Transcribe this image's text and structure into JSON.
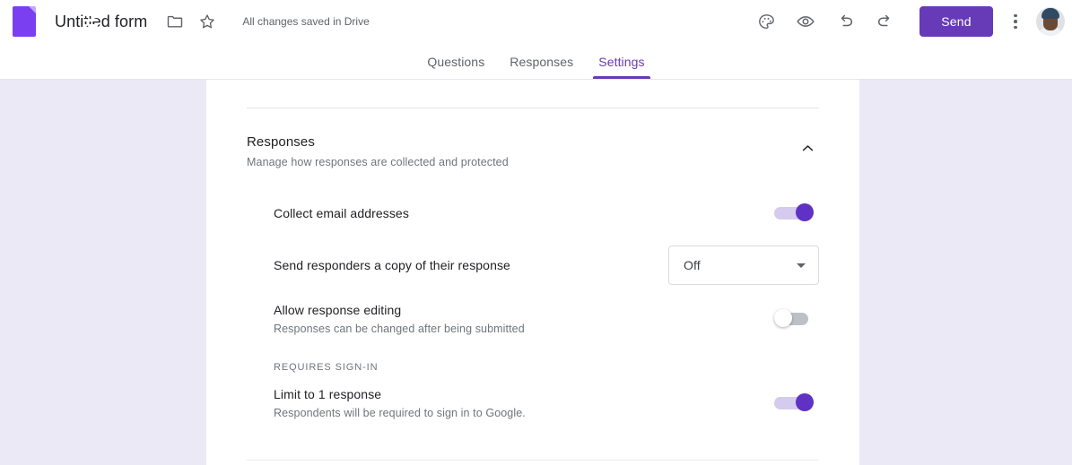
{
  "topbar": {
    "logo_icon": "google-forms-icon",
    "form_title": "Untitled form",
    "folder_icon": "folder-icon",
    "star_icon": "star-icon",
    "save_status": "All changes saved in Drive",
    "theme_icon": "palette-icon",
    "preview_icon": "eye-icon",
    "undo_icon": "undo-icon",
    "redo_icon": "redo-icon",
    "send_label": "Send",
    "more_icon": "more-vertical-icon",
    "avatar_name": "account-avatar",
    "accent_color": "#673ab7"
  },
  "tabs": [
    {
      "label": "Questions",
      "active": false
    },
    {
      "label": "Responses",
      "active": false
    },
    {
      "label": "Settings",
      "active": true
    }
  ],
  "responses_section": {
    "title": "Responses",
    "subtitle": "Manage how responses are collected and protected",
    "collapse_icon": "chevron-up-icon",
    "settings": [
      {
        "label": "Collect email addresses",
        "sublabel": "",
        "control": "toggle",
        "state": "on"
      },
      {
        "label": "Send responders a copy of their response",
        "sublabel": "",
        "control": "dropdown",
        "value": "Off",
        "caret_icon": "chevron-down-icon"
      },
      {
        "label": "Allow response editing",
        "sublabel": "Responses can be changed after being submitted",
        "control": "toggle",
        "state": "off"
      }
    ],
    "signin_group_label": "REQUIRES SIGN-IN",
    "signin_settings": [
      {
        "label": "Limit to 1 response",
        "sublabel": "Respondents will be required to sign in to Google.",
        "control": "toggle",
        "state": "on"
      }
    ]
  },
  "colors": {
    "page_background": "#ece9f6",
    "card_background": "#ffffff",
    "toggle_on_knob": "#5f31c4",
    "toggle_on_track": "#d4cbee",
    "toggle_off_track": "#bdc1c6"
  }
}
